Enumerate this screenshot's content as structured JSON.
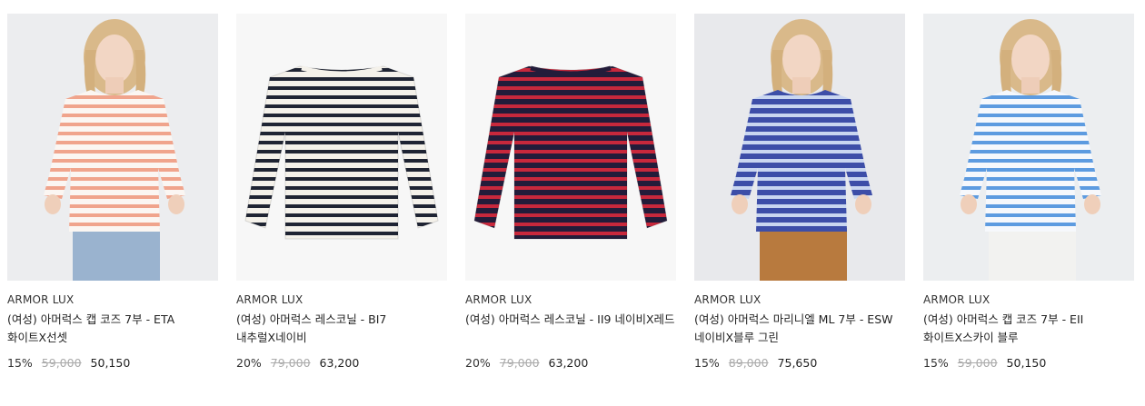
{
  "products": [
    {
      "brand": "ARMOR LUX",
      "name": "(여성) 아머럭스 캡 코즈 7부 - ETA 화이트X선셋",
      "discount": "15%",
      "original_price": "59,000",
      "sale_price": "50,150",
      "image": {
        "kind": "model",
        "base": "#fbf6f2",
        "stripe": "#f0a48c",
        "bg": "#ecedef",
        "bottom": "#9ab3cf"
      }
    },
    {
      "brand": "ARMOR LUX",
      "name": "(여성) 아머럭스 레스코닐 - BI7 내추럴X네이비",
      "discount": "20%",
      "original_price": "79,000",
      "sale_price": "63,200",
      "image": {
        "kind": "flat",
        "base": "#f4f1ea",
        "stripe": "#1f2433",
        "bg": "#f7f7f7"
      }
    },
    {
      "brand": "ARMOR LUX",
      "name": "(여성) 아머럭스 레스코닐 - II9 네이비X레드",
      "discount": "20%",
      "original_price": "79,000",
      "sale_price": "63,200",
      "image": {
        "kind": "flat",
        "base": "#231c3a",
        "stripe": "#c8283c",
        "bg": "#f7f7f7"
      }
    },
    {
      "brand": "ARMOR LUX",
      "name": "(여성) 아머럭스 마리니엘 ML 7부 - ESW 네이비X블루 그린",
      "discount": "15%",
      "original_price": "89,000",
      "sale_price": "75,650",
      "image": {
        "kind": "model",
        "base": "#3d4ea8",
        "stripe": "#c9d6f0",
        "bg": "#e8e9ec",
        "bottom": "#b87a3e"
      }
    },
    {
      "brand": "ARMOR LUX",
      "name": "(여성) 아머럭스 캡 코즈 7부 - EII 화이트X스카이 블루",
      "discount": "15%",
      "original_price": "59,000",
      "sale_price": "50,150",
      "image": {
        "kind": "model",
        "base": "#f6f8fc",
        "stripe": "#5d9be0",
        "bg": "#eceef0",
        "bottom": "#f2f2f0"
      }
    }
  ]
}
